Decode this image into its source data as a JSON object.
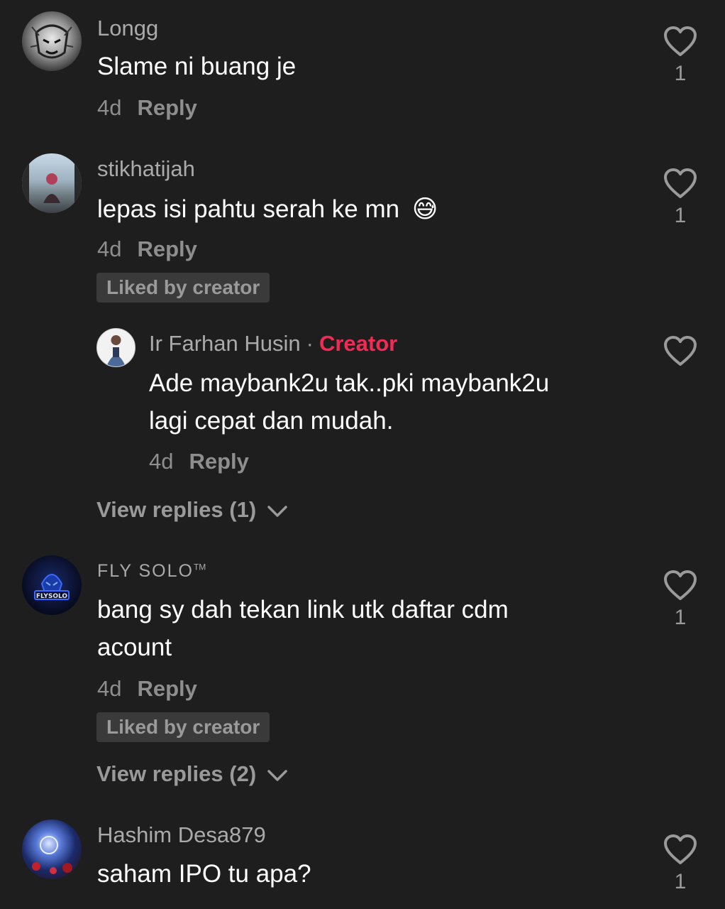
{
  "comments": [
    {
      "username": "Longg",
      "text": "Slame ni buang je",
      "time": "4d",
      "reply_label": "Reply",
      "likes": "1"
    },
    {
      "username": "stikhatijah",
      "text": "lepas isi pahtu serah ke mn",
      "emoji": "😅",
      "time": "4d",
      "reply_label": "Reply",
      "likes": "1",
      "badge": "Liked by creator",
      "reply": {
        "username": "Ir Farhan Husin",
        "creator_label": "Creator",
        "text_line1": "Ade maybank2u tak..pki maybank2u",
        "text_line2": "lagi cepat dan mudah.",
        "time": "4d",
        "reply_label": "Reply"
      },
      "view_replies": "View replies (1)"
    },
    {
      "username": "FLY SOLO",
      "username_tm": "TM",
      "avatar_text": "FLYSOLO",
      "text_line1": "bang sy dah tekan link utk daftar cdm",
      "text_line2": "acount",
      "time": "4d",
      "reply_label": "Reply",
      "likes": "1",
      "badge": "Liked by creator",
      "view_replies": "View replies (2)"
    },
    {
      "username": "Hashim Desa879",
      "text": "saham IPO tu apa?",
      "likes": "1"
    }
  ],
  "colors": {
    "background": "#1e1e1e",
    "creator": "#f02c56",
    "muted": "#8e8e8e",
    "badge_bg": "#3a3a3a"
  },
  "icons": {
    "like": "heart-outline-icon",
    "expand": "chevron-down-icon"
  }
}
